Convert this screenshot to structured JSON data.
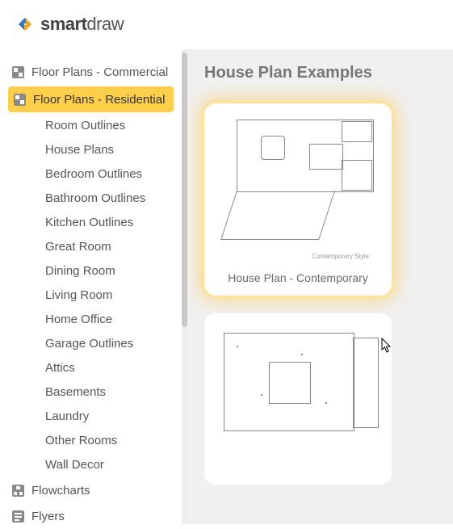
{
  "brand": "smartdraw",
  "brand_bold_prefix": "smart",
  "brand_rest": "draw",
  "sidebar": {
    "categories": [
      {
        "label": "Floor Plans - Commercial",
        "icon": "floorplan-icon",
        "selected": false
      },
      {
        "label": "Floor Plans - Residential",
        "icon": "floorplan-icon",
        "selected": true
      }
    ],
    "subitems": [
      "Room Outlines",
      "House Plans",
      "Bedroom Outlines",
      "Bathroom Outlines",
      "Kitchen Outlines",
      "Great Room",
      "Dining Room",
      "Living Room",
      "Home Office",
      "Garage Outlines",
      "Attics",
      "Basements",
      "Laundry",
      "Other Rooms",
      "Wall Decor"
    ],
    "after_categories": [
      {
        "label": "Flowcharts",
        "icon": "flowchart-icon"
      },
      {
        "label": "Flyers",
        "icon": "flyers-icon"
      }
    ]
  },
  "content": {
    "title": "House Plan Examples",
    "cards": [
      {
        "label": "House Plan - Contemporary",
        "thumb_caption": "Contemporary Style",
        "highlight": true
      },
      {
        "label": "",
        "thumb_caption": ""
      }
    ]
  }
}
